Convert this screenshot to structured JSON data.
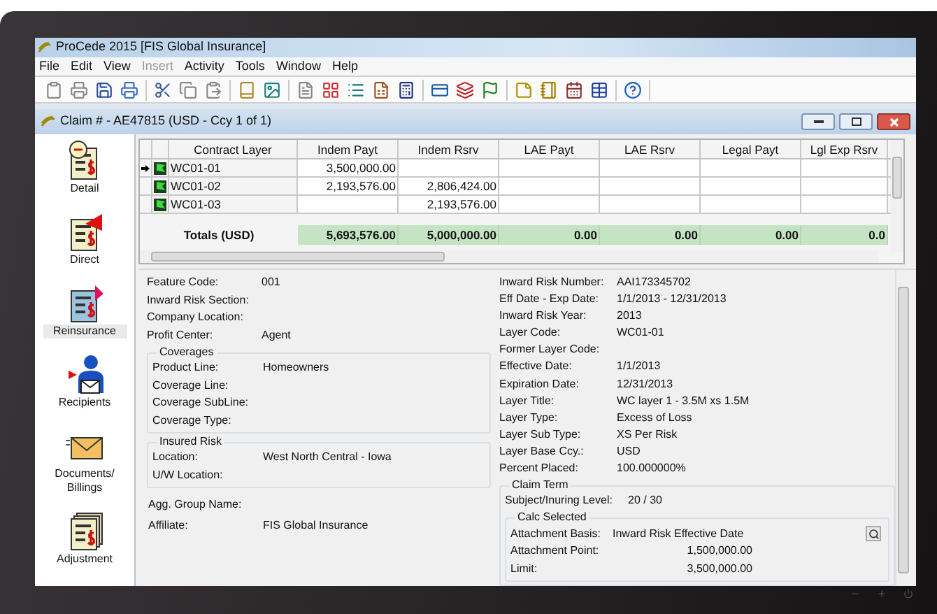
{
  "app": {
    "title": "ProCede 2015 [FIS Global Insurance]"
  },
  "menu": [
    {
      "label": "File",
      "disabled": false
    },
    {
      "label": "Edit",
      "disabled": false
    },
    {
      "label": "View",
      "disabled": false
    },
    {
      "label": "Insert",
      "disabled": true
    },
    {
      "label": "Activity",
      "disabled": false
    },
    {
      "label": "Tools",
      "disabled": false
    },
    {
      "label": "Window",
      "disabled": false
    },
    {
      "label": "Help",
      "disabled": false
    }
  ],
  "claim_window": {
    "title": "Claim # - AE47815 (USD - Ccy 1 of 1)"
  },
  "sidebar": [
    {
      "label": "Detail",
      "kind": "detail",
      "selected": false
    },
    {
      "label": "Direct",
      "kind": "direct",
      "selected": false
    },
    {
      "label": "Reinsurance",
      "kind": "reinsurance",
      "selected": true
    },
    {
      "label": "Recipients",
      "kind": "recipients",
      "selected": false
    },
    {
      "label": "Documents/ Billings",
      "kind": "documents",
      "selected": false
    },
    {
      "label": "Adjustment",
      "kind": "adjustment",
      "selected": false
    }
  ],
  "grid": {
    "columns": [
      "Contract Layer",
      "Indem Payt",
      "Indem Rsrv",
      "LAE Payt",
      "LAE Rsrv",
      "Legal Payt",
      "Lgl Exp Rsrv"
    ],
    "rows": [
      {
        "selected": true,
        "cells": [
          "WC01-01",
          "3,500,000.00",
          "",
          "",
          "",
          "",
          ""
        ]
      },
      {
        "selected": false,
        "cells": [
          "WC01-02",
          "2,193,576.00",
          "2,806,424.00",
          "",
          "",
          "",
          ""
        ]
      },
      {
        "selected": false,
        "cells": [
          "WC01-03",
          "",
          "2,193,576.00",
          "",
          "",
          "",
          ""
        ]
      }
    ],
    "totals": {
      "label": "Totals (USD)",
      "values": [
        "5,693,576.00",
        "5,000,000.00",
        "0.00",
        "0.00",
        "0.00",
        "0.0"
      ]
    }
  },
  "details_left": {
    "fields": [
      {
        "label": "Feature Code:",
        "value": "001"
      },
      {
        "label": "Inward Risk Section:"
      },
      {
        "label": "Company Location:"
      },
      {
        "label": "Profit Center:",
        "value": "Agent"
      }
    ],
    "coverages": {
      "legend": "Coverages",
      "fields": [
        {
          "label": "Product Line:",
          "value": "Homeowners"
        },
        {
          "label": "Coverage Line:"
        },
        {
          "label": "Coverage SubLine:"
        },
        {
          "label": "Coverage Type:"
        }
      ]
    },
    "insured_risk": {
      "legend": "Insured Risk",
      "fields": [
        {
          "label": "Location:",
          "value": "West North Central - Iowa"
        },
        {
          "label": "U/W Location:"
        }
      ]
    },
    "fields_after": [
      {
        "label": "Agg. Group Name:"
      },
      {
        "label": "Affiliate:",
        "value": "FIS Global Insurance"
      }
    ]
  },
  "details_right": {
    "fields": [
      {
        "label": "Inward Risk Number:",
        "value": "AAI173345702"
      },
      {
        "label": "Eff Date - Exp Date:",
        "value": "1/1/2013 - 12/31/2013"
      },
      {
        "label": "Inward Risk Year:",
        "value": "2013"
      },
      {
        "label": "Layer Code:",
        "value": "WC01-01"
      },
      {
        "label": "Former Layer Code:"
      },
      {
        "label": "Effective Date:",
        "value": "1/1/2013"
      },
      {
        "label": "Expiration Date:",
        "value": "12/31/2013"
      },
      {
        "label": "Layer Title:",
        "value": "WC layer 1 - 3.5M xs 1.5M"
      },
      {
        "label": "Layer Type:",
        "value": "Excess of Loss"
      },
      {
        "label": "Layer Sub Type:",
        "value": "XS Per Risk"
      },
      {
        "label": "Layer Base Ccy.:",
        "value": "USD"
      },
      {
        "label": "Percent Placed:",
        "value": "100.000000%"
      }
    ],
    "claim_term": {
      "legend": "Claim Term",
      "label": "Subject/Inuring Level:",
      "value": "20 /   30",
      "calc": {
        "legend": "Calc Selected",
        "fields": [
          {
            "label": "Attachment Basis:",
            "value": "Inward Risk Effective Date",
            "kind": "text"
          },
          {
            "label": "Attachment Point:",
            "value": "1,500,000.00",
            "kind": "amount"
          },
          {
            "label": "Limit:",
            "value": "3,500,000.00",
            "kind": "amount"
          }
        ]
      }
    }
  }
}
